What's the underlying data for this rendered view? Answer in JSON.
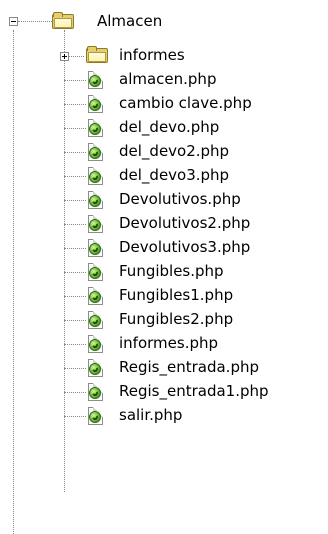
{
  "tree": {
    "root": {
      "label": "Almacen",
      "icon": "open-folder-icon",
      "expanded": true
    },
    "children": [
      {
        "label": "informes",
        "icon": "folder-icon",
        "type": "folder",
        "expanded": false
      },
      {
        "label": "almacen.php",
        "icon": "php-file-icon",
        "type": "file"
      },
      {
        "label": "cambio clave.php",
        "icon": "php-file-icon",
        "type": "file"
      },
      {
        "label": "del_devo.php",
        "icon": "php-file-icon",
        "type": "file"
      },
      {
        "label": "del_devo2.php",
        "icon": "php-file-icon",
        "type": "file"
      },
      {
        "label": "del_devo3.php",
        "icon": "php-file-icon",
        "type": "file"
      },
      {
        "label": "Devolutivos.php",
        "icon": "php-file-icon",
        "type": "file"
      },
      {
        "label": "Devolutivos2.php",
        "icon": "php-file-icon",
        "type": "file"
      },
      {
        "label": "Devolutivos3.php",
        "icon": "php-file-icon",
        "type": "file"
      },
      {
        "label": "Fungibles.php",
        "icon": "php-file-icon",
        "type": "file"
      },
      {
        "label": "Fungibles1.php",
        "icon": "php-file-icon",
        "type": "file"
      },
      {
        "label": "Fungibles2.php",
        "icon": "php-file-icon",
        "type": "file"
      },
      {
        "label": "informes.php",
        "icon": "php-file-icon",
        "type": "file"
      },
      {
        "label": "Regis_entrada.php",
        "icon": "php-file-icon",
        "type": "file"
      },
      {
        "label": "Regis_entrada1.php",
        "icon": "php-file-icon",
        "type": "file"
      },
      {
        "label": "salir.php",
        "icon": "php-file-icon",
        "type": "file"
      }
    ]
  }
}
